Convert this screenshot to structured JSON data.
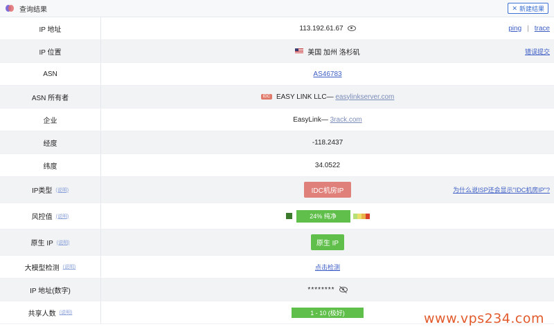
{
  "header": {
    "title": "查询结果",
    "new_button": "新建结果"
  },
  "rows": {
    "ip": {
      "label": "IP 地址",
      "value": "113.192.61.67",
      "ping": "ping",
      "sep": "|",
      "trace": "trace"
    },
    "location": {
      "label": "IP 位置",
      "value": "美国 加州 洛杉矶",
      "action": "错误提交"
    },
    "asn": {
      "label": "ASN",
      "value": "AS46783"
    },
    "asn_owner": {
      "label": "ASN 所有者",
      "tag": "IDC",
      "name": "EASY LINK LLC—",
      "domain": "easylinkserver.com"
    },
    "company": {
      "label": "企业",
      "name": "EasyLink—",
      "domain": "3rack.com"
    },
    "longitude": {
      "label": "经度",
      "value": "-118.2437"
    },
    "latitude": {
      "label": "纬度",
      "value": "34.0522"
    },
    "ip_type": {
      "label": "IP类型",
      "help": "(说明)",
      "value": "IDC机房IP",
      "question": "为什么说ISP还会显示\"IDC机房IP\"?"
    },
    "risk": {
      "label": "风控值",
      "help": "(说明)",
      "value": "24%  纯净",
      "percent": 24
    },
    "native_ip": {
      "label": "原生 IP",
      "help": "(说明)",
      "value": "原生 IP"
    },
    "llm_check": {
      "label": "大模型检测",
      "help": "(说明)",
      "value": "点击检测"
    },
    "ip_numeric": {
      "label": "IP 地址(数字)",
      "value": "********"
    },
    "shared": {
      "label": "共享人数",
      "help": "(说明)",
      "value": "1 - 10 (极好)"
    }
  },
  "watermark": "www.vps234.com",
  "colors": {
    "accent": "#3b5cc4",
    "badge_green": "#5fbf4a",
    "badge_red": "#e0807a",
    "watermark": "#e25a2c"
  },
  "icons": {
    "logo": "app-logo",
    "new": "close-x-icon",
    "eye": "eye-icon",
    "eye_off": "eye-off-icon",
    "flag": "us-flag-icon"
  }
}
